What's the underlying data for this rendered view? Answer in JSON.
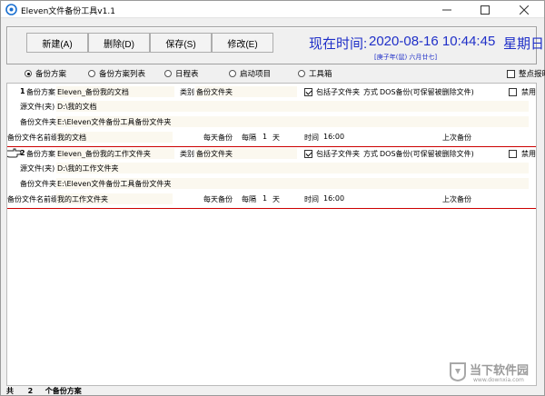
{
  "window": {
    "title": "Eleven文件备份工具v1.1"
  },
  "toolbar": {
    "new_label": "新建(A)",
    "delete_label": "删除(D)",
    "save_label": "保存(S)",
    "edit_label": "修改(E)"
  },
  "clock": {
    "label": "现在时间:",
    "datetime": "2020-08-16  10:44:45",
    "weekday": "星期日",
    "lunar": "[庚子年(鼠) 六月廿七]"
  },
  "view_tabs": [
    {
      "label": "备份方案",
      "selected": true
    },
    {
      "label": "备份方案列表",
      "selected": false
    },
    {
      "label": "日程表",
      "selected": false
    },
    {
      "label": "启动项目",
      "selected": false
    },
    {
      "label": "工具箱",
      "selected": false
    }
  ],
  "hourly_check": {
    "label": "整点报时",
    "checked": false
  },
  "plans": [
    {
      "number": "1",
      "plan_label": "备份方案",
      "plan_name": "Eleven_备份我的文档",
      "category_label": "类别",
      "category": "备份文件夹",
      "include_sub_label": "包括子文件夹",
      "include_sub": true,
      "mode_label": "方式",
      "mode": "DOS备份(可保留被删除文件)",
      "disable_label": "禁用",
      "disabled": false,
      "source_label": "源文件(夹)",
      "source": "D:\\我的文档",
      "backup_label": "备份文件夹",
      "backup": "E:\\Eleven文件备份工具备份文件夹",
      "prefix_label": "备份文件名前缀",
      "prefix": "我的文档",
      "freq": "每天备份",
      "interval_label": "每隔",
      "interval": "1",
      "interval_unit": "天",
      "time_label": "时间",
      "time": "16:00",
      "last_label": "上次备份"
    },
    {
      "number": "2",
      "plan_label": "备份方案",
      "plan_name": "Eleven_备份我的工作文件夹",
      "category_label": "类别",
      "category": "备份文件夹",
      "include_sub_label": "包括子文件夹",
      "include_sub": true,
      "mode_label": "方式",
      "mode": "DOS备份(可保留被删除文件)",
      "disable_label": "禁用",
      "disabled": false,
      "source_label": "源文件(夹)",
      "source": "D:\\我的工作文件夹",
      "backup_label": "备份文件夹",
      "backup": "E:\\Eleven文件备份工具备份文件夹",
      "prefix_label": "备份文件名前缀",
      "prefix": "我的工作文件夹",
      "freq": "每天备份",
      "interval_label": "每隔",
      "interval": "1",
      "interval_unit": "天",
      "time_label": "时间",
      "time": "16:00",
      "last_label": "上次备份"
    }
  ],
  "status": {
    "total_label": "共",
    "count": "2",
    "suffix": "个备份方案"
  },
  "watermark": {
    "brand": "当下软件园",
    "url": "www.downxia.com"
  }
}
